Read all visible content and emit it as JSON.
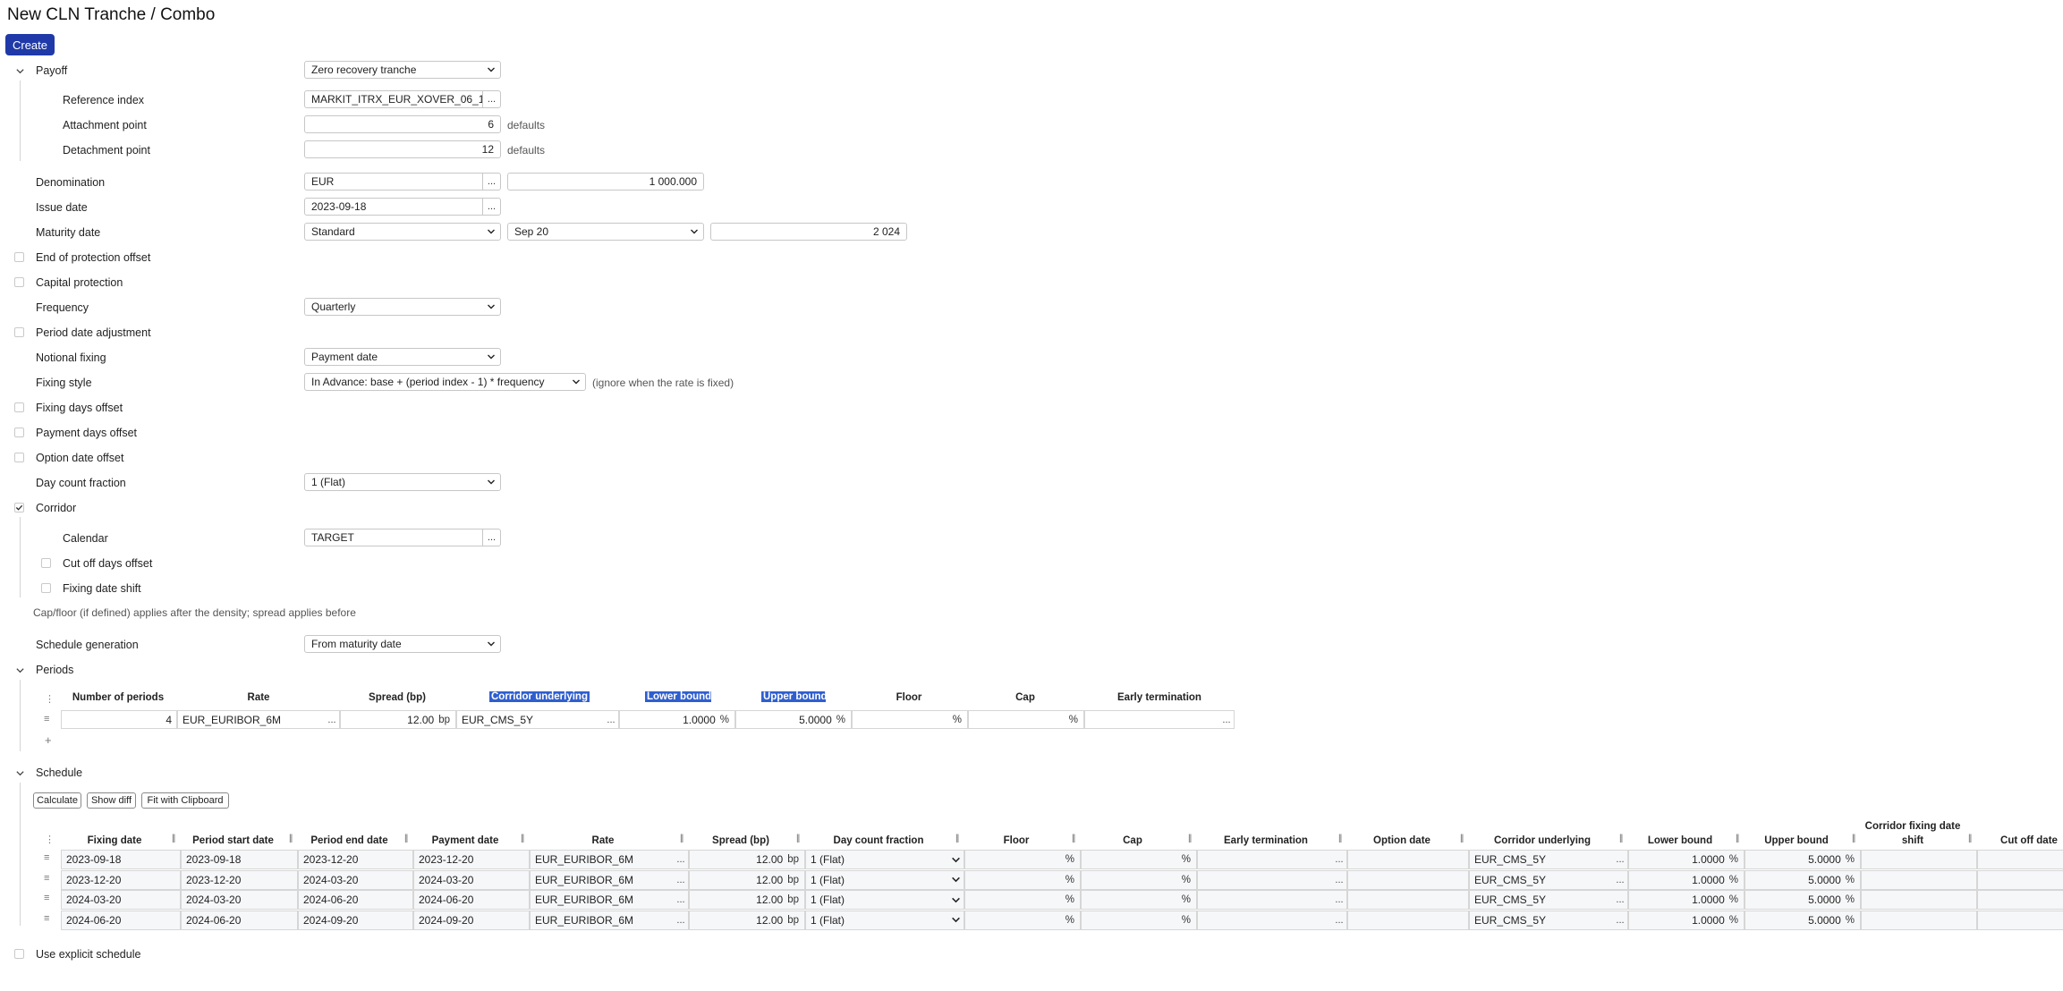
{
  "page": {
    "title": "New CLN Tranche / Combo",
    "create_label": "Create"
  },
  "payoff": {
    "label": "Payoff",
    "value": "Zero recovery tranche",
    "reference_index": {
      "label": "Reference index",
      "value": "MARKIT_ITRX_EUR_XOVER_06_1",
      "dots": "..."
    },
    "attachment_point": {
      "label": "Attachment point",
      "value": "6",
      "suffix": "defaults"
    },
    "detachment_point": {
      "label": "Detachment point",
      "value": "12",
      "suffix": "defaults"
    }
  },
  "denomination": {
    "label": "Denomination",
    "currency": "EUR",
    "dots": "...",
    "amount": "1 000.000"
  },
  "issue_date": {
    "label": "Issue date",
    "value": "2023-09-18",
    "dots": "..."
  },
  "maturity_date": {
    "label": "Maturity date",
    "rule": "Standard",
    "month": "Sep 20",
    "year": "2 024"
  },
  "end_of_protection_offset": {
    "label": "End of protection offset",
    "checked": false
  },
  "capital_protection": {
    "label": "Capital protection",
    "checked": false
  },
  "frequency": {
    "label": "Frequency",
    "value": "Quarterly"
  },
  "period_date_adjustment": {
    "label": "Period date adjustment",
    "checked": false
  },
  "notional_fixing": {
    "label": "Notional fixing",
    "value": "Payment date"
  },
  "fixing_style": {
    "label": "Fixing style",
    "value": "In Advance: base + (period index - 1) * frequency",
    "hint": "(ignore when the rate is fixed)"
  },
  "fixing_days_offset": {
    "label": "Fixing days offset",
    "checked": false
  },
  "payment_days_offset": {
    "label": "Payment days offset",
    "checked": false
  },
  "option_date_offset": {
    "label": "Option date offset",
    "checked": false
  },
  "day_count_fraction": {
    "label": "Day count fraction",
    "value": "1 (Flat)"
  },
  "corridor": {
    "label": "Corridor",
    "checked": true,
    "calendar": {
      "label": "Calendar",
      "value": "TARGET",
      "dots": "..."
    },
    "cut_off_days_offset": {
      "label": "Cut off days offset",
      "checked": false
    },
    "fixing_date_shift": {
      "label": "Fixing date shift",
      "checked": false
    },
    "note": "Cap/floor (if defined) applies after the density; spread applies before"
  },
  "schedule_generation": {
    "label": "Schedule generation",
    "value": "From maturity date"
  },
  "periods": {
    "label": "Periods",
    "headers": [
      "Number of periods",
      "Rate",
      "Spread (bp)",
      "Corridor underlying",
      "Lower bound",
      "Upper bound",
      "Floor",
      "Cap",
      "Early termination"
    ],
    "row": {
      "number_of_periods": "4",
      "rate": "EUR_EURIBOR_6M",
      "spread": "12.00",
      "spread_unit": "bp",
      "corridor_underlying": "EUR_CMS_5Y",
      "lower_bound": "1.0000",
      "upper_bound": "5.0000",
      "pct": "%",
      "dots": "...",
      "floor": "",
      "cap": "",
      "early_termination": ""
    },
    "add": "+"
  },
  "schedule": {
    "label": "Schedule",
    "buttons": [
      "Calculate",
      "Show diff",
      "Fit with Clipboard"
    ],
    "headers": [
      "Fixing date",
      "Period start date",
      "Period end date",
      "Payment date",
      "Rate",
      "Spread (bp)",
      "Day count fraction",
      "Floor",
      "Cap",
      "Early termination",
      "Option date",
      "Corridor underlying",
      "Lower bound",
      "Upper bound",
      "Corridor fixing date shift",
      "Cut off date"
    ],
    "rows": [
      {
        "fixing": "2023-09-18",
        "start": "2023-09-18",
        "end": "2023-12-20",
        "payment": "2023-12-20",
        "rate": "EUR_EURIBOR_6M",
        "spread": "12.00",
        "unit": "bp",
        "dcf": "1 (Flat)",
        "underlying": "EUR_CMS_5Y",
        "lower": "1.0000",
        "upper": "5.0000"
      },
      {
        "fixing": "2023-12-20",
        "start": "2023-12-20",
        "end": "2024-03-20",
        "payment": "2024-03-20",
        "rate": "EUR_EURIBOR_6M",
        "spread": "12.00",
        "unit": "bp",
        "dcf": "1 (Flat)",
        "underlying": "EUR_CMS_5Y",
        "lower": "1.0000",
        "upper": "5.0000"
      },
      {
        "fixing": "2024-03-20",
        "start": "2024-03-20",
        "end": "2024-06-20",
        "payment": "2024-06-20",
        "rate": "EUR_EURIBOR_6M",
        "spread": "12.00",
        "unit": "bp",
        "dcf": "1 (Flat)",
        "underlying": "EUR_CMS_5Y",
        "lower": "1.0000",
        "upper": "5.0000"
      },
      {
        "fixing": "2024-06-20",
        "start": "2024-06-20",
        "end": "2024-09-20",
        "payment": "2024-09-20",
        "rate": "EUR_EURIBOR_6M",
        "spread": "12.00",
        "unit": "bp",
        "dcf": "1 (Flat)",
        "underlying": "EUR_CMS_5Y",
        "lower": "1.0000",
        "upper": "5.0000"
      }
    ],
    "pct": "%",
    "dots": "..."
  },
  "use_explicit_schedule": {
    "label": "Use explicit schedule",
    "checked": false
  },
  "icons": {
    "chevron": "chevron-down-icon",
    "dropdown": "caret-down-icon",
    "check": "check-icon",
    "drag": "drag-handle-icon",
    "menu": "vertical-dots-icon"
  },
  "colors": {
    "primary": "#1f3aa8",
    "highlight": "#2f5fcf",
    "border": "#c7c7c7"
  }
}
